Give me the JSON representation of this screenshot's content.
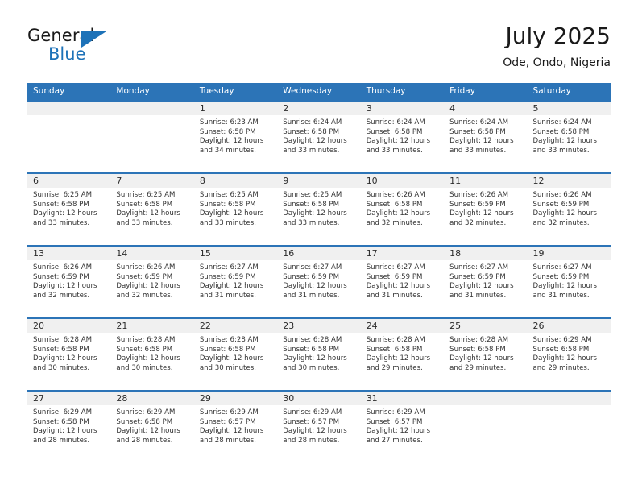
{
  "logo": {
    "primary_text": "General",
    "secondary_text": "Blue",
    "triangle_color": "#1d72b8",
    "primary_color": "#1a1a1a",
    "secondary_color": "#1d72b8"
  },
  "header": {
    "title": "July 2025",
    "subtitle": "Ode, Ondo, Nigeria"
  },
  "theme": {
    "header_blue": "#2c74b7",
    "band_gray": "#f0f0f0",
    "text_dark": "#333333"
  },
  "weekdays": [
    {
      "label": "Sunday"
    },
    {
      "label": "Monday"
    },
    {
      "label": "Tuesday"
    },
    {
      "label": "Wednesday"
    },
    {
      "label": "Thursday"
    },
    {
      "label": "Friday"
    },
    {
      "label": "Saturday"
    }
  ],
  "weeks": [
    {
      "days": [
        {
          "day": "",
          "empty": true,
          "lines": []
        },
        {
          "day": "",
          "empty": true,
          "lines": []
        },
        {
          "day": "1",
          "empty": false,
          "lines": [
            "Sunrise: 6:23 AM",
            "Sunset: 6:58 PM",
            "Daylight: 12 hours",
            "and 34 minutes."
          ]
        },
        {
          "day": "2",
          "empty": false,
          "lines": [
            "Sunrise: 6:24 AM",
            "Sunset: 6:58 PM",
            "Daylight: 12 hours",
            "and 33 minutes."
          ]
        },
        {
          "day": "3",
          "empty": false,
          "lines": [
            "Sunrise: 6:24 AM",
            "Sunset: 6:58 PM",
            "Daylight: 12 hours",
            "and 33 minutes."
          ]
        },
        {
          "day": "4",
          "empty": false,
          "lines": [
            "Sunrise: 6:24 AM",
            "Sunset: 6:58 PM",
            "Daylight: 12 hours",
            "and 33 minutes."
          ]
        },
        {
          "day": "5",
          "empty": false,
          "lines": [
            "Sunrise: 6:24 AM",
            "Sunset: 6:58 PM",
            "Daylight: 12 hours",
            "and 33 minutes."
          ]
        }
      ]
    },
    {
      "days": [
        {
          "day": "6",
          "empty": false,
          "lines": [
            "Sunrise: 6:25 AM",
            "Sunset: 6:58 PM",
            "Daylight: 12 hours",
            "and 33 minutes."
          ]
        },
        {
          "day": "7",
          "empty": false,
          "lines": [
            "Sunrise: 6:25 AM",
            "Sunset: 6:58 PM",
            "Daylight: 12 hours",
            "and 33 minutes."
          ]
        },
        {
          "day": "8",
          "empty": false,
          "lines": [
            "Sunrise: 6:25 AM",
            "Sunset: 6:58 PM",
            "Daylight: 12 hours",
            "and 33 minutes."
          ]
        },
        {
          "day": "9",
          "empty": false,
          "lines": [
            "Sunrise: 6:25 AM",
            "Sunset: 6:58 PM",
            "Daylight: 12 hours",
            "and 33 minutes."
          ]
        },
        {
          "day": "10",
          "empty": false,
          "lines": [
            "Sunrise: 6:26 AM",
            "Sunset: 6:58 PM",
            "Daylight: 12 hours",
            "and 32 minutes."
          ]
        },
        {
          "day": "11",
          "empty": false,
          "lines": [
            "Sunrise: 6:26 AM",
            "Sunset: 6:59 PM",
            "Daylight: 12 hours",
            "and 32 minutes."
          ]
        },
        {
          "day": "12",
          "empty": false,
          "lines": [
            "Sunrise: 6:26 AM",
            "Sunset: 6:59 PM",
            "Daylight: 12 hours",
            "and 32 minutes."
          ]
        }
      ]
    },
    {
      "days": [
        {
          "day": "13",
          "empty": false,
          "lines": [
            "Sunrise: 6:26 AM",
            "Sunset: 6:59 PM",
            "Daylight: 12 hours",
            "and 32 minutes."
          ]
        },
        {
          "day": "14",
          "empty": false,
          "lines": [
            "Sunrise: 6:26 AM",
            "Sunset: 6:59 PM",
            "Daylight: 12 hours",
            "and 32 minutes."
          ]
        },
        {
          "day": "15",
          "empty": false,
          "lines": [
            "Sunrise: 6:27 AM",
            "Sunset: 6:59 PM",
            "Daylight: 12 hours",
            "and 31 minutes."
          ]
        },
        {
          "day": "16",
          "empty": false,
          "lines": [
            "Sunrise: 6:27 AM",
            "Sunset: 6:59 PM",
            "Daylight: 12 hours",
            "and 31 minutes."
          ]
        },
        {
          "day": "17",
          "empty": false,
          "lines": [
            "Sunrise: 6:27 AM",
            "Sunset: 6:59 PM",
            "Daylight: 12 hours",
            "and 31 minutes."
          ]
        },
        {
          "day": "18",
          "empty": false,
          "lines": [
            "Sunrise: 6:27 AM",
            "Sunset: 6:59 PM",
            "Daylight: 12 hours",
            "and 31 minutes."
          ]
        },
        {
          "day": "19",
          "empty": false,
          "lines": [
            "Sunrise: 6:27 AM",
            "Sunset: 6:59 PM",
            "Daylight: 12 hours",
            "and 31 minutes."
          ]
        }
      ]
    },
    {
      "days": [
        {
          "day": "20",
          "empty": false,
          "lines": [
            "Sunrise: 6:28 AM",
            "Sunset: 6:58 PM",
            "Daylight: 12 hours",
            "and 30 minutes."
          ]
        },
        {
          "day": "21",
          "empty": false,
          "lines": [
            "Sunrise: 6:28 AM",
            "Sunset: 6:58 PM",
            "Daylight: 12 hours",
            "and 30 minutes."
          ]
        },
        {
          "day": "22",
          "empty": false,
          "lines": [
            "Sunrise: 6:28 AM",
            "Sunset: 6:58 PM",
            "Daylight: 12 hours",
            "and 30 minutes."
          ]
        },
        {
          "day": "23",
          "empty": false,
          "lines": [
            "Sunrise: 6:28 AM",
            "Sunset: 6:58 PM",
            "Daylight: 12 hours",
            "and 30 minutes."
          ]
        },
        {
          "day": "24",
          "empty": false,
          "lines": [
            "Sunrise: 6:28 AM",
            "Sunset: 6:58 PM",
            "Daylight: 12 hours",
            "and 29 minutes."
          ]
        },
        {
          "day": "25",
          "empty": false,
          "lines": [
            "Sunrise: 6:28 AM",
            "Sunset: 6:58 PM",
            "Daylight: 12 hours",
            "and 29 minutes."
          ]
        },
        {
          "day": "26",
          "empty": false,
          "lines": [
            "Sunrise: 6:29 AM",
            "Sunset: 6:58 PM",
            "Daylight: 12 hours",
            "and 29 minutes."
          ]
        }
      ]
    },
    {
      "days": [
        {
          "day": "27",
          "empty": false,
          "lines": [
            "Sunrise: 6:29 AM",
            "Sunset: 6:58 PM",
            "Daylight: 12 hours",
            "and 28 minutes."
          ]
        },
        {
          "day": "28",
          "empty": false,
          "lines": [
            "Sunrise: 6:29 AM",
            "Sunset: 6:58 PM",
            "Daylight: 12 hours",
            "and 28 minutes."
          ]
        },
        {
          "day": "29",
          "empty": false,
          "lines": [
            "Sunrise: 6:29 AM",
            "Sunset: 6:57 PM",
            "Daylight: 12 hours",
            "and 28 minutes."
          ]
        },
        {
          "day": "30",
          "empty": false,
          "lines": [
            "Sunrise: 6:29 AM",
            "Sunset: 6:57 PM",
            "Daylight: 12 hours",
            "and 28 minutes."
          ]
        },
        {
          "day": "31",
          "empty": false,
          "lines": [
            "Sunrise: 6:29 AM",
            "Sunset: 6:57 PM",
            "Daylight: 12 hours",
            "and 27 minutes."
          ]
        },
        {
          "day": "",
          "empty": true,
          "lines": []
        },
        {
          "day": "",
          "empty": true,
          "lines": []
        }
      ]
    }
  ]
}
